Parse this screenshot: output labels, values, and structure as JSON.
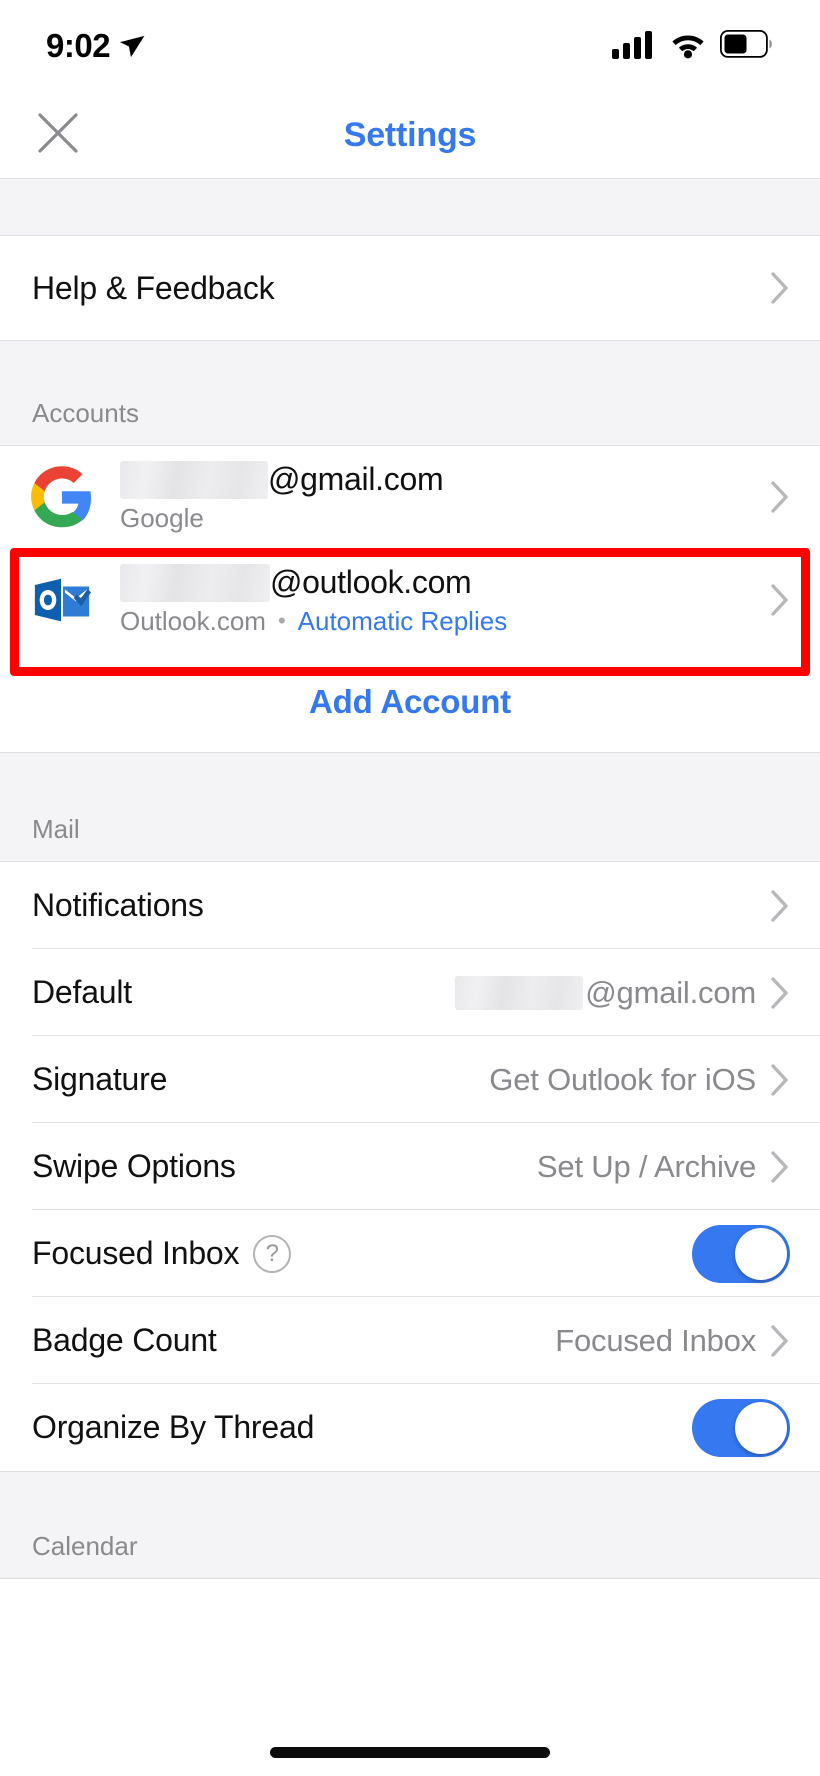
{
  "status_bar": {
    "time": "9:02",
    "location_icon": "location-arrow-icon",
    "signal_icon": "cellular-signal-icon",
    "wifi_icon": "wifi-icon",
    "battery_icon": "battery-icon"
  },
  "header": {
    "close_icon": "close-icon",
    "title": "Settings",
    "title_color": "#3578F0"
  },
  "help_section": {
    "rows": [
      {
        "label": "Help & Feedback",
        "accessory": "chevron-right-icon"
      }
    ]
  },
  "accounts_section": {
    "header": "Accounts",
    "accounts": [
      {
        "logo": "google-logo-icon",
        "email_redacted": true,
        "email_domain": "@gmail.com",
        "subtitle": "Google",
        "accessory": "chevron-right-icon",
        "highlighted": false
      },
      {
        "logo": "outlook-logo-icon",
        "email_redacted": true,
        "email_domain": "@outlook.com",
        "subtitle": "Outlook.com",
        "separator": "•",
        "link_label": "Automatic Replies",
        "accessory": "chevron-right-icon",
        "highlighted": true
      }
    ],
    "add_account_label": "Add Account"
  },
  "mail_section": {
    "header": "Mail",
    "rows": [
      {
        "label": "Notifications",
        "value": "",
        "type": "chevron"
      },
      {
        "label": "Default",
        "value": "@gmail.com",
        "value_redacted": true,
        "type": "chevron"
      },
      {
        "label": "Signature",
        "value": "Get Outlook for iOS",
        "type": "chevron"
      },
      {
        "label": "Swipe Options",
        "value": "Set Up / Archive",
        "type": "chevron"
      },
      {
        "label": "Focused Inbox",
        "value": "",
        "type": "toggle",
        "toggle_on": true,
        "help_icon": "question-mark-icon"
      },
      {
        "label": "Badge Count",
        "value": "Focused Inbox",
        "type": "chevron"
      },
      {
        "label": "Organize By Thread",
        "value": "",
        "type": "toggle",
        "toggle_on": true
      }
    ]
  },
  "calendar_section": {
    "header": "Calendar"
  },
  "colors": {
    "accent_blue": "#3578F0",
    "highlight_red": "#FF0000",
    "gray_text": "#8A8A8E",
    "group_bg": "#F4F4F6"
  }
}
